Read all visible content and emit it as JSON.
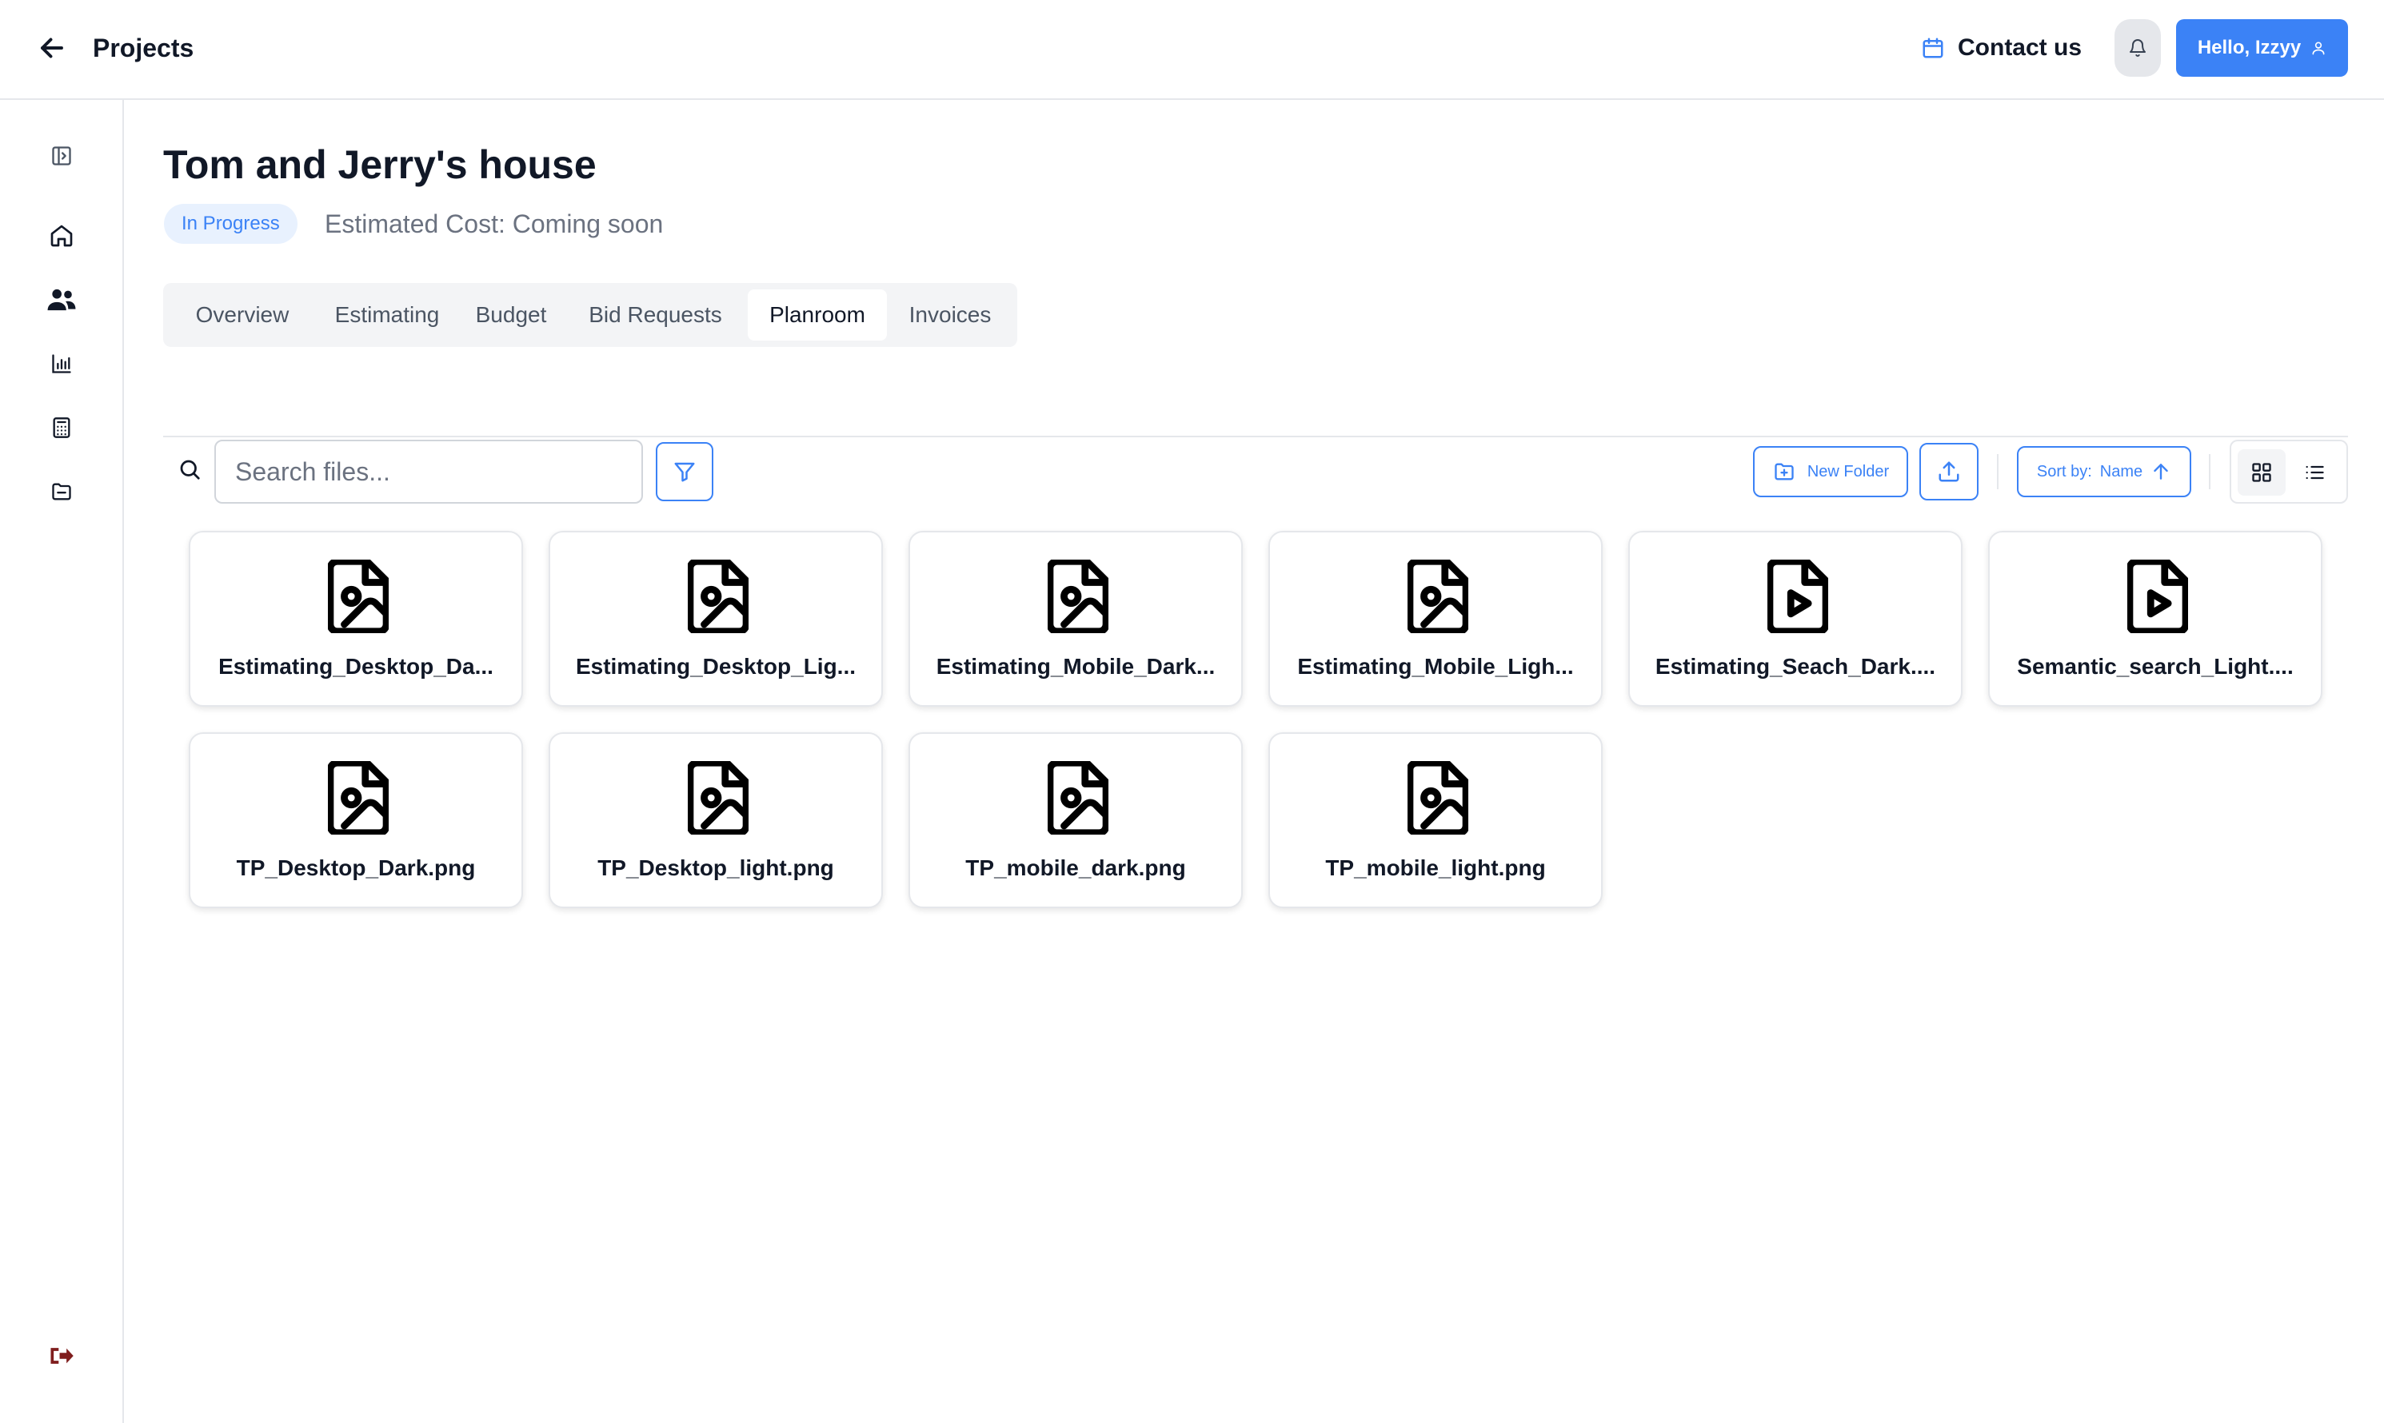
{
  "header": {
    "back_icon": "arrow-left-icon",
    "title": "Projects",
    "contact_label": "Contact us",
    "contact_icon": "calendar-icon",
    "notification_icon": "bell-icon",
    "user_greeting": "Hello, Izzyy",
    "user_icon": "user-icon"
  },
  "sidebar": {
    "items": [
      {
        "icon": "sidebar-toggle-icon"
      },
      {
        "icon": "home-icon"
      },
      {
        "icon": "users-icon"
      },
      {
        "icon": "bar-chart-icon"
      },
      {
        "icon": "calculator-icon"
      },
      {
        "icon": "folder-icon"
      }
    ],
    "logout_icon": "logout-icon"
  },
  "project": {
    "title": "Tom and Jerry's house",
    "status": "In Progress",
    "estimated_cost": "Estimated Cost: Coming soon"
  },
  "tabs": [
    {
      "label": "Overview",
      "active": false
    },
    {
      "label": "Estimating",
      "active": false
    },
    {
      "label": "Budget",
      "active": false
    },
    {
      "label": "Bid Requests",
      "active": false
    },
    {
      "label": "Planroom",
      "active": true
    },
    {
      "label": "Invoices",
      "active": false
    }
  ],
  "toolbar": {
    "search_placeholder": "Search files...",
    "search_value": "",
    "new_folder_label": "New Folder",
    "sort_label": "Sort by:",
    "sort_value": "Name",
    "sort_direction": "ascending",
    "view_mode": "grid"
  },
  "files": [
    {
      "name": "Estimating_Desktop_Da...",
      "type": "image"
    },
    {
      "name": "Estimating_Desktop_Lig...",
      "type": "image"
    },
    {
      "name": "Estimating_Mobile_Dark...",
      "type": "image"
    },
    {
      "name": "Estimating_Mobile_Ligh...",
      "type": "image"
    },
    {
      "name": "Estimating_Seach_Dark....",
      "type": "video"
    },
    {
      "name": "Semantic_search_Light....",
      "type": "video"
    },
    {
      "name": "TP_Desktop_Dark.png",
      "type": "image"
    },
    {
      "name": "TP_Desktop_light.png",
      "type": "image"
    },
    {
      "name": "TP_mobile_dark.png",
      "type": "image"
    },
    {
      "name": "TP_mobile_light.png",
      "type": "image"
    }
  ],
  "colors": {
    "accent": "#3b82f6",
    "badge_bg": "#e8f1fe",
    "logout": "#7f1d1d",
    "border": "#e5e7eb"
  }
}
